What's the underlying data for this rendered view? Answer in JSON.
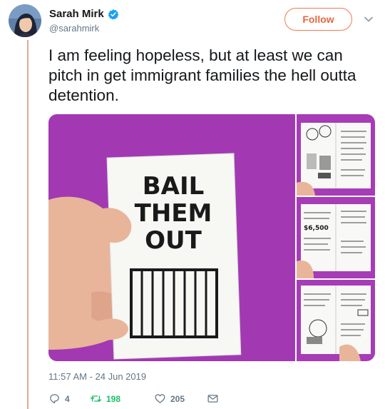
{
  "user": {
    "name": "Sarah Mirk",
    "handle": "@sarahmirk",
    "follow_label": "Follow"
  },
  "tweet": {
    "text": "I am feeling hopeless, but at least we can pitch in get immigrant families the hell outta detention.",
    "timestamp": "11:57 AM - 24 Jun 2019"
  },
  "zine": {
    "cover_line1": "BAIL",
    "cover_line2": "THEM",
    "cover_line3": "OUT",
    "amount": "$6,500"
  },
  "stats": {
    "replies": "4",
    "retweets": "198",
    "likes": "205"
  },
  "colors": {
    "accent": "#e8683f",
    "retweet": "#17bf63",
    "verified": "#1da1f2",
    "purple_bg": "#a63cb6"
  },
  "icons": [
    "verified-badge-icon",
    "chevron-down-icon",
    "reply-icon",
    "retweet-icon",
    "heart-icon",
    "envelope-icon"
  ]
}
